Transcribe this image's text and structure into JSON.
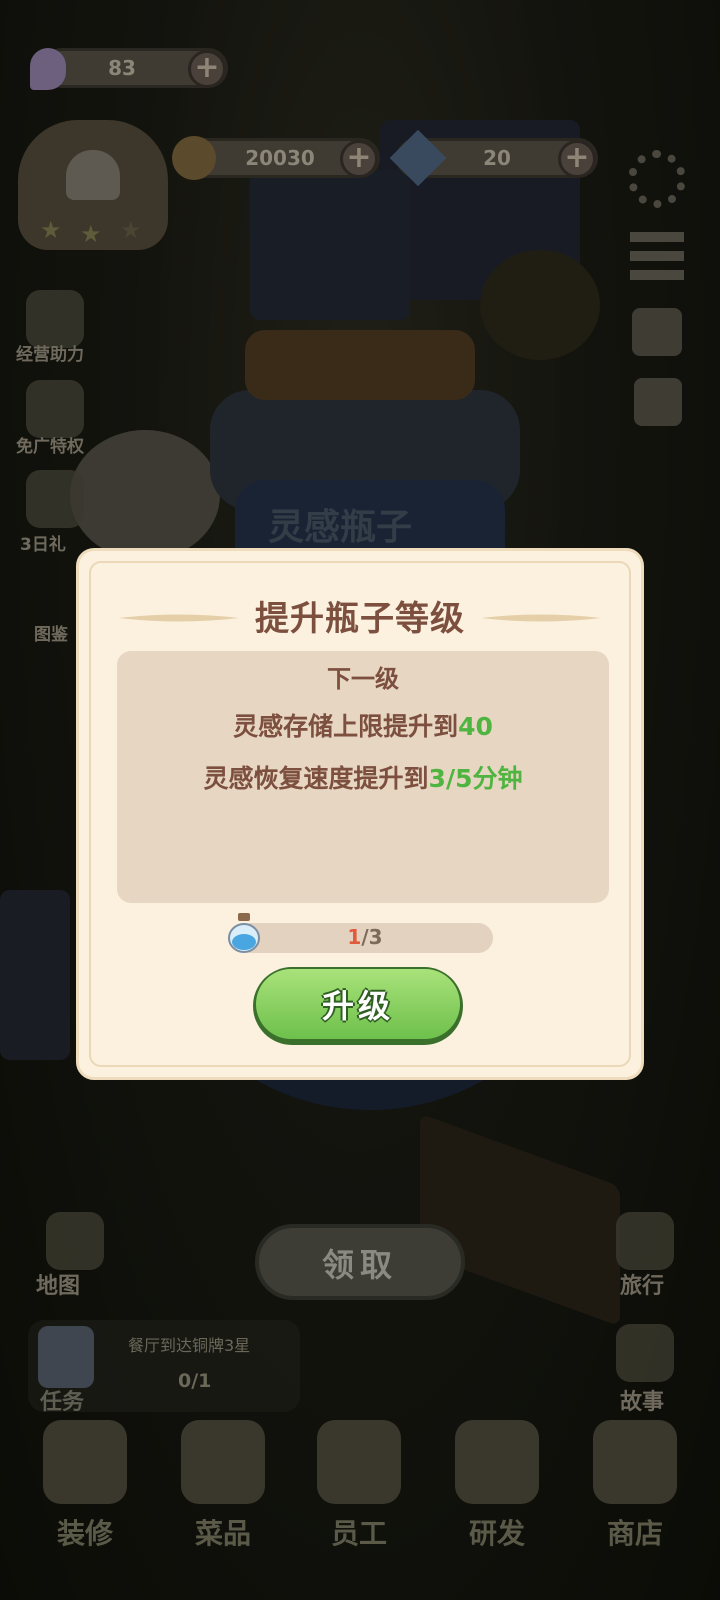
{
  "hud": {
    "inspiration_count": "83",
    "coins": "20030",
    "gems": "20"
  },
  "left_menu": {
    "items": [
      "经营助力",
      "免广特权",
      "3日礼",
      "图鉴"
    ]
  },
  "right_menu": {
    "items": [
      "旅行",
      "故事"
    ]
  },
  "bottle_title": "灵感瓶子",
  "dialog": {
    "title": "提升瓶子等级",
    "subtitle": "下一级",
    "line1_prefix": "灵感存储上限提升到",
    "line1_value": "40",
    "line2_prefix": "灵感恢复速度提升到",
    "line2_value": "3/5分钟",
    "progress_current": "1",
    "progress_total": "/3",
    "progress_fraction": 0.333,
    "upgrade_label": "升级"
  },
  "collect_label": "领取",
  "map_label": "地图",
  "task": {
    "label": "任务",
    "text": "餐厅到达铜牌3星",
    "progress": "0/1"
  },
  "nav": {
    "items": [
      "装修",
      "菜品",
      "员工",
      "研发",
      "商店"
    ]
  },
  "colors": {
    "accent_green": "#4fb540",
    "title_brown": "#7c4f3f",
    "progress_red": "#e15a3c"
  }
}
